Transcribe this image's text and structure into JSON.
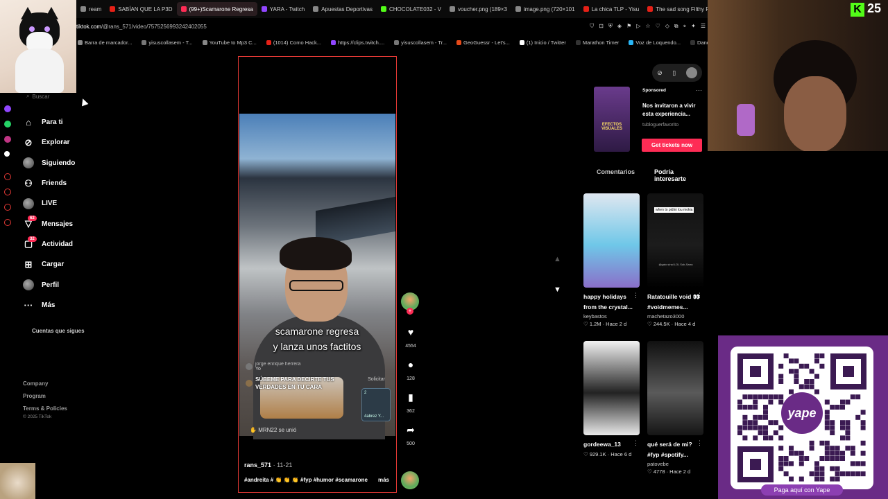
{
  "browser": {
    "tabs": [
      {
        "label": "ream",
        "color": "#888"
      },
      {
        "label": "SABÍAN QUE LA P3D",
        "color": "#e62117"
      },
      {
        "label": "(99+)Scamarone Regresa",
        "color": "#fe2c55",
        "active": true
      },
      {
        "label": "YARA - Twitch",
        "color": "#9146ff"
      },
      {
        "label": "Apuestas Deportivas",
        "color": "#888"
      },
      {
        "label": "CHOCOLATE032 - V",
        "color": "#53fc18"
      },
      {
        "label": "voucher.png (189×3",
        "color": "#888"
      },
      {
        "label": "image.png (720×101",
        "color": "#888"
      },
      {
        "label": "La chica TLP - Yisu",
        "color": "#e62117"
      },
      {
        "label": "The sad song Filthy F",
        "color": "#e62117"
      }
    ],
    "url_host": "tiktok.com",
    "url_path": "/@rans_571/video/7575256993242402055",
    "bookmarks": [
      {
        "label": "Barra de marcador...",
        "color": "#888"
      },
      {
        "label": "yisuscollasem - T...",
        "color": "#777"
      },
      {
        "label": "YouTube to Mp3 C...",
        "color": "#888"
      },
      {
        "label": "(1014) Como Hack...",
        "color": "#e62117"
      },
      {
        "label": "https://clips.twitch....",
        "color": "#9146ff"
      },
      {
        "label": "yisuscollasem - Tr...",
        "color": "#777"
      },
      {
        "label": "GeoGuessr - Let's...",
        "color": "#e64a19"
      },
      {
        "label": "(1) Inicio / Twitter",
        "color": "#fff"
      },
      {
        "label": "Marathon Timer",
        "color": "#333"
      },
      {
        "label": "Voz de Loquendo...",
        "color": "#29b6f6"
      },
      {
        "label": "Dandadan, Capítul...",
        "color": "#333"
      }
    ]
  },
  "sidebar": {
    "search_placeholder": "Buscar",
    "items": [
      {
        "label": "Para ti",
        "icon": "⌂"
      },
      {
        "label": "Explorar",
        "icon": "⊘"
      },
      {
        "label": "Siguiendo",
        "icon": "avatar"
      },
      {
        "label": "Friends",
        "icon": "⚇"
      },
      {
        "label": "LIVE",
        "icon": "avatar"
      },
      {
        "label": "Mensajes",
        "icon": "▽",
        "badge": "62"
      },
      {
        "label": "Actividad",
        "icon": "▢",
        "badge": "32"
      },
      {
        "label": "Cargar",
        "icon": "⊞"
      },
      {
        "label": "Perfil",
        "icon": "avatar"
      },
      {
        "label": "Más",
        "icon": "···"
      }
    ],
    "following_title": "Cuentas que sigues",
    "footer": [
      "Company",
      "Program",
      "Terms & Policies"
    ],
    "copyright": "© 2025 TikTok"
  },
  "video": {
    "caption_line1": "scamarone regresa",
    "caption_line2": "y lanza unos factitos",
    "chat": [
      {
        "name": "jorge enrique herrera",
        "text": "Yo"
      }
    ],
    "chat_bold": "SÚBEME PARA DECIRTE TUS VERDADES EN TU CARA",
    "solicitar": "Solicitar",
    "gift_label": "4abrez Y...",
    "gift_count": "2",
    "joined_user": "MRN22",
    "joined_text": "se unió",
    "author": "rans_571",
    "date": "11-21",
    "tags": "#andreita # 👏 👏 👏  #fyp #humor #scamarone",
    "more": "más"
  },
  "actions": {
    "likes": "4554",
    "comments": "128",
    "saves": "362",
    "shares": "500"
  },
  "ad": {
    "thumb_text": "EFECTOS VISUALES",
    "sponsored": "Sponsored",
    "text": "Nos invitaron a vivir esta experiencia...",
    "handle": "tubloguerfavorito",
    "button": "Get tickets now"
  },
  "right_tabs": {
    "comments": "Comentarios",
    "interest": "Podría interesarte"
  },
  "cards": [
    {
      "title": "happy holidays from the crystal...",
      "author": "keybastos",
      "likes": "1.2M",
      "age": "Hace 2 d",
      "colors": [
        "#dfe7f0",
        "#6fc7e8",
        "#8a6fc9"
      ]
    },
    {
      "title": "Ratatouille void 👀 #voidmemes...",
      "author": "machetazo3000",
      "likes": "244.5K",
      "age": "Hace 4 d",
      "overlay": "when to pidini lou mokia",
      "subtext": "@gato sinal LOL Sub-Sarra",
      "colors": [
        "#111",
        "#1c1c1c",
        "#000"
      ]
    },
    {
      "title": "gordeewa_13",
      "author": "",
      "likes": "929.1K",
      "age": "Hace 6 d",
      "colors": [
        "#f2f2f2",
        "#222",
        "#e9e9e9"
      ]
    },
    {
      "title": "qué será de mi? #fyp #spotify...",
      "author": "patovebe",
      "likes": "4778",
      "age": "Hace 2 d",
      "colors": [
        "#101010",
        "#5a5a5a",
        "#151515"
      ]
    }
  ],
  "overlay": {
    "viewer_count": "25",
    "kick_color": "#53fc18",
    "qr_logo": "yape",
    "qr_label": "Paga aquí con Yape"
  }
}
